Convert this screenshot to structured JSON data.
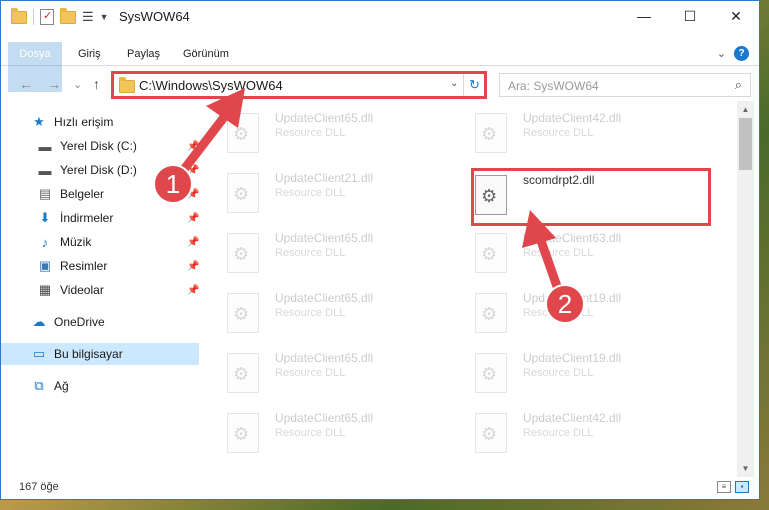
{
  "window": {
    "title": "SysWOW64",
    "controls": {
      "minimize": "—",
      "maximize": "☐",
      "close": "✕"
    }
  },
  "ribbon": {
    "tabs": [
      "Dosya",
      "Giriş",
      "Paylaş",
      "Görünüm"
    ],
    "help_label": "?"
  },
  "nav": {
    "back": "←",
    "forward": "→",
    "recent": "⌄",
    "up": "↑",
    "address": "C:\\Windows\\SysWOW64",
    "search_placeholder": "Ara: SysWOW64"
  },
  "sidebar": {
    "items": [
      {
        "label": "Hızlı erişim",
        "icon": "star-icon",
        "pinned": false
      },
      {
        "label": "Yerel Disk (C:)",
        "icon": "drive-icon",
        "pinned": true
      },
      {
        "label": "Yerel Disk (D:)",
        "icon": "drive-icon",
        "pinned": true
      },
      {
        "label": "Belgeler",
        "icon": "documents-icon",
        "pinned": true
      },
      {
        "label": "İndirmeler",
        "icon": "download-icon",
        "pinned": true
      },
      {
        "label": "Müzik",
        "icon": "music-icon",
        "pinned": true
      },
      {
        "label": "Resimler",
        "icon": "pictures-icon",
        "pinned": true
      },
      {
        "label": "Videolar",
        "icon": "videos-icon",
        "pinned": true
      },
      {
        "label": "OneDrive",
        "icon": "cloud-icon",
        "pinned": false
      },
      {
        "label": "Bu bilgisayar",
        "icon": "computer-icon",
        "pinned": false,
        "selected": true
      },
      {
        "label": "Ağ",
        "icon": "network-icon",
        "pinned": false
      }
    ]
  },
  "files": {
    "left_column": [
      {
        "name": "UpdateClient65.dll",
        "type": "Resource DLL"
      },
      {
        "name": "UpdateClient21.dll",
        "type": "Resource DLL"
      },
      {
        "name": "UpdateClient65.dll",
        "type": "Resource DLL"
      },
      {
        "name": "UpdateClient65.dll",
        "type": "Resource DLL"
      },
      {
        "name": "UpdateClient65.dll",
        "type": "Resource DLL"
      },
      {
        "name": "UpdateClient65.dll",
        "type": "Resource DLL"
      }
    ],
    "right_column": [
      {
        "name": "UpdateClient42.dll",
        "type": "Resource DLL"
      },
      {
        "name": "scomdrpt2.dll",
        "type": "",
        "highlighted": true
      },
      {
        "name": "UpdateClient63.dll",
        "type": "Resource DLL"
      },
      {
        "name": "UpdateClient19.dll",
        "type": "Resource DLL"
      },
      {
        "name": "UpdateClient19.dll",
        "type": "Resource DLL"
      },
      {
        "name": "UpdateClient42.dll",
        "type": "Resource DLL"
      }
    ]
  },
  "status": {
    "item_count": "167 öğe"
  },
  "annotations": [
    "1",
    "2"
  ],
  "colors": {
    "accent": "#1979ca",
    "highlight": "#e0474c",
    "selection": "#cce8ff"
  }
}
